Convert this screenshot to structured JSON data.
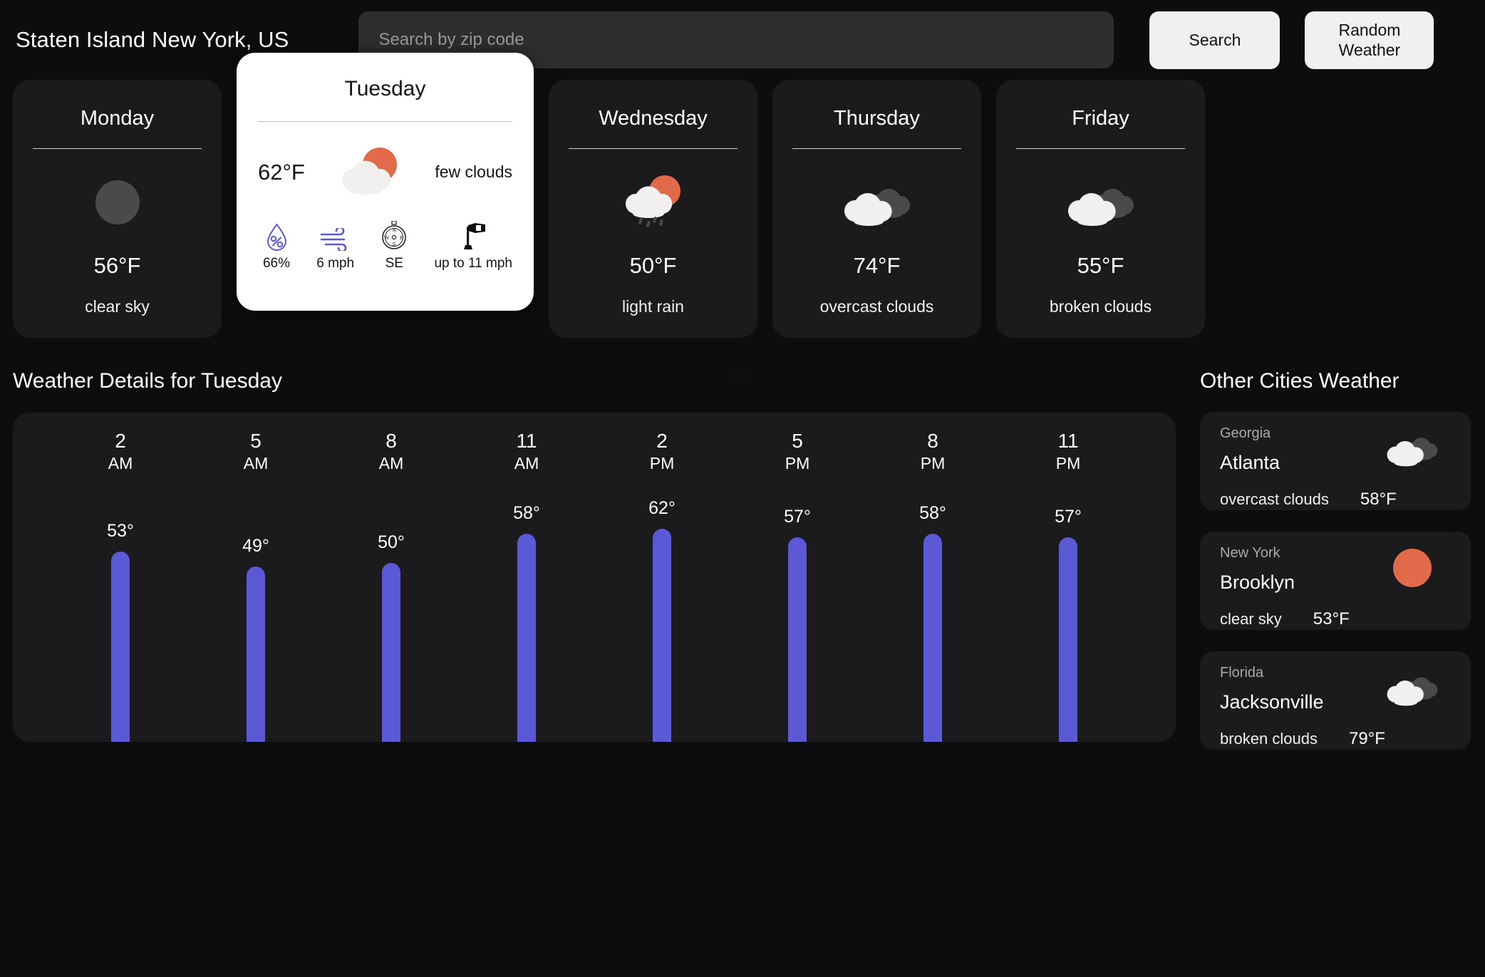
{
  "header": {
    "location": "Staten Island New York, US",
    "search_placeholder": "Search by zip code",
    "search_value": "",
    "search_button": "Search",
    "random_button": "Random Weather"
  },
  "forecast": {
    "days": [
      {
        "name": "Monday",
        "icon": "sun-dark-circle-icon",
        "temp": "56°F",
        "desc": "clear sky",
        "active": false
      },
      {
        "name": "Tuesday",
        "icon": "sun-behind-cloud-icon",
        "temp": "62°F",
        "desc": "few clouds",
        "active": true,
        "stats": [
          {
            "icon": "humidity-droplet-icon",
            "label": "66%"
          },
          {
            "icon": "wind-icon",
            "label": "6 mph"
          },
          {
            "icon": "compass-icon",
            "label": "SE"
          },
          {
            "icon": "windsock-icon",
            "label": "up to 11 mph"
          }
        ]
      },
      {
        "name": "Wednesday",
        "icon": "sun-behind-rain-cloud-icon",
        "temp": "50°F",
        "desc": "light rain",
        "active": false
      },
      {
        "name": "Thursday",
        "icon": "overcast-clouds-icon",
        "temp": "74°F",
        "desc": "overcast clouds",
        "active": false
      },
      {
        "name": "Friday",
        "icon": "broken-clouds-icon",
        "temp": "55°F",
        "desc": "broken clouds",
        "active": false
      }
    ]
  },
  "details": {
    "title": "Weather Details for Tuesday",
    "stray_text": "Text"
  },
  "chart_data": {
    "type": "bar",
    "title": "Weather Details for Tuesday",
    "xlabel": "",
    "ylabel": "",
    "categories": [
      "2 AM",
      "5 AM",
      "8 AM",
      "11 AM",
      "2 PM",
      "5 PM",
      "8 PM",
      "11 PM"
    ],
    "hour_numbers": [
      "2",
      "5",
      "8",
      "11",
      "2",
      "5",
      "8",
      "11"
    ],
    "hour_meridiems": [
      "AM",
      "AM",
      "AM",
      "AM",
      "PM",
      "PM",
      "PM",
      "PM"
    ],
    "values": [
      53,
      49,
      50,
      58,
      62,
      57,
      58,
      57
    ],
    "value_labels": [
      "53°",
      "49°",
      "50°",
      "58°",
      "62°",
      "57°",
      "58°",
      "57°"
    ],
    "ylim": [
      0,
      68
    ],
    "bar_color": "#5b59d6",
    "grid": false,
    "legend": null
  },
  "other_cities": {
    "title": "Other Cities Weather",
    "cards": [
      {
        "state": "Georgia",
        "city": "Atlanta",
        "desc": "overcast clouds",
        "temp": "58°F",
        "icon": "overcast-clouds-icon"
      },
      {
        "state": "New York",
        "city": "Brooklyn",
        "desc": "clear sky",
        "temp": "53°F",
        "icon": "sun-icon"
      },
      {
        "state": "Florida",
        "city": "Jacksonville",
        "desc": "broken clouds",
        "temp": "79°F",
        "icon": "broken-clouds-icon"
      }
    ]
  },
  "colors": {
    "background": "#0d0d0f",
    "card": "#1b1b1d",
    "active_card": "#ffffff",
    "accent_bar": "#5b59d6",
    "sun": "#e06a4a",
    "cloud_light": "#f1f0ee",
    "cloud_dark": "#4a4a4a"
  }
}
